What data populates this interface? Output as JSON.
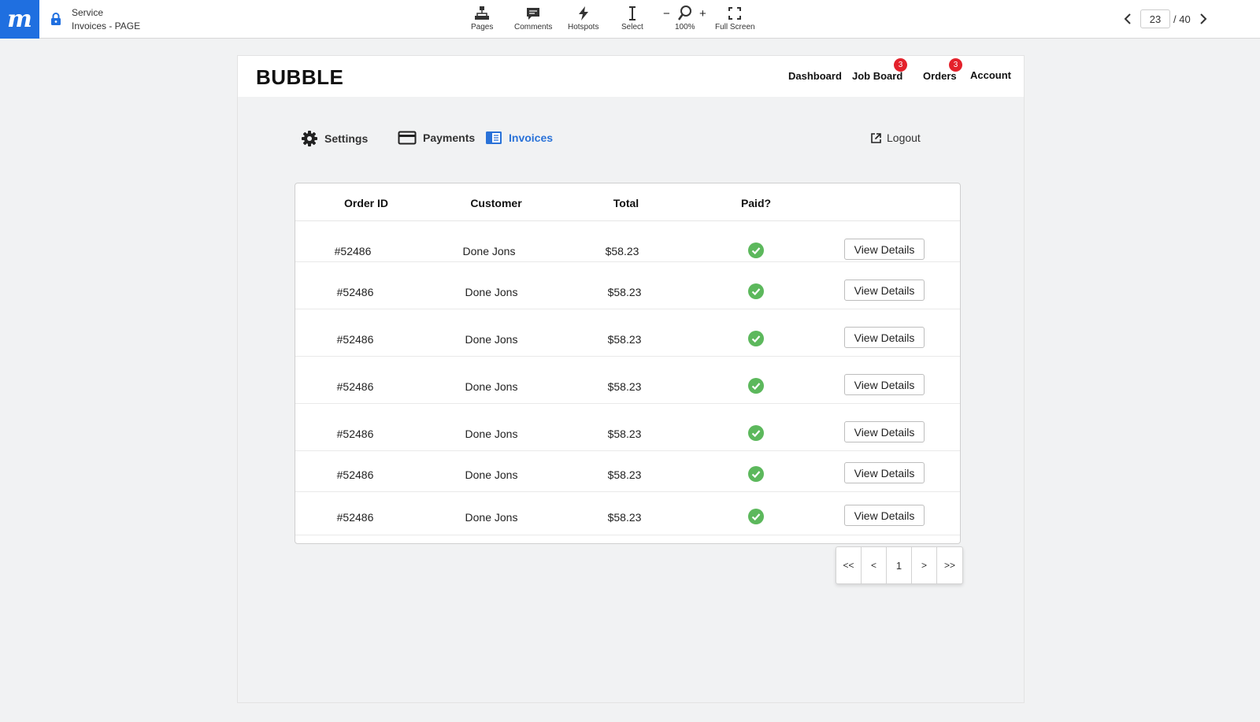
{
  "toolbar": {
    "logo": "m",
    "breadcrumb_project": "Service",
    "breadcrumb_page": "Invoices - PAGE",
    "pages_label": "Pages",
    "comments_label": "Comments",
    "hotspots_label": "Hotspots",
    "select_label": "Select",
    "zoom_minus": "−",
    "zoom_plus": "+",
    "zoom_level": "100%",
    "fullscreen_label": "Full Screen",
    "current_page": "23",
    "total_pages": "/ 40"
  },
  "app": {
    "brand": "BUBBLE",
    "nav": {
      "dashboard": "Dashboard",
      "job_board": "Job Board",
      "job_board_badge": "3",
      "orders": "Orders",
      "orders_badge": "3",
      "account": "Account"
    },
    "tabs": {
      "settings": "Settings",
      "payments": "Payments",
      "invoices": "Invoices",
      "logout": "Logout"
    },
    "accent_color": "#2a72d8",
    "paid_color": "#5cb85c"
  },
  "table": {
    "headers": {
      "order_id": "Order ID",
      "customer": "Customer",
      "total": "Total",
      "paid": "Paid?"
    },
    "rows": [
      {
        "order_id": "#52486",
        "customer": "Done Jons",
        "total": "$58.23",
        "paid": true,
        "action": "View Details"
      },
      {
        "order_id": "#52486",
        "customer": "Done Jons",
        "total": "$58.23",
        "paid": true,
        "action": "View Details"
      },
      {
        "order_id": "#52486",
        "customer": "Done Jons",
        "total": "$58.23",
        "paid": true,
        "action": "View Details"
      },
      {
        "order_id": "#52486",
        "customer": "Done Jons",
        "total": "$58.23",
        "paid": true,
        "action": "View Details"
      },
      {
        "order_id": "#52486",
        "customer": "Done Jons",
        "total": "$58.23",
        "paid": true,
        "action": "View Details"
      },
      {
        "order_id": "#52486",
        "customer": "Done Jons",
        "total": "$58.23",
        "paid": true,
        "action": "View Details"
      },
      {
        "order_id": "#52486",
        "customer": "Done Jons",
        "total": "$58.23",
        "paid": true,
        "action": "View Details"
      }
    ]
  },
  "pagination": {
    "first": "<<",
    "prev": "<",
    "current": "1",
    "next": ">",
    "last": ">>"
  }
}
